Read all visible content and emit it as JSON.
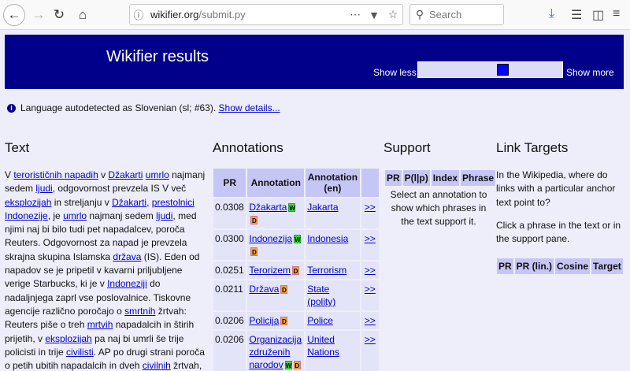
{
  "browser": {
    "url_host": "wikifier.org",
    "url_path": "/submit.py",
    "search_placeholder": "Search"
  },
  "header": {
    "title": "Wikifier results",
    "show_less": "Show less",
    "show_more": "Show more",
    "slider_level": 0.6
  },
  "lang_notice": {
    "text": "Language autodetected as Slovenian (sl; #63). ",
    "link": "Show details..."
  },
  "sections": {
    "text": "Text",
    "annotations": "Annotations",
    "support": "Support",
    "link_targets": "Link Targets"
  },
  "text_body": [
    {
      "t": "V "
    },
    {
      "l": "terorističnih napadih"
    },
    {
      "t": " v "
    },
    {
      "l": "Džakarti"
    },
    {
      "t": " "
    },
    {
      "l": "umrlo"
    },
    {
      "t": " najmanj sedem "
    },
    {
      "l": "ljudi"
    },
    {
      "t": ", odgovornost prevzela IS V več "
    },
    {
      "l": "eksplozijah"
    },
    {
      "t": " in streljanju v "
    },
    {
      "l": "Džakarti"
    },
    {
      "t": ", "
    },
    {
      "l": "prestolnici"
    },
    {
      "t": " "
    },
    {
      "l": "Indonezije"
    },
    {
      "t": ", je "
    },
    {
      "l": "umrlo"
    },
    {
      "t": " najmanj sedem "
    },
    {
      "l": "ljudi"
    },
    {
      "t": ", med njimi naj bi bilo tudi pet napadalcev, poroča Reuters. Odgovornost za napad je prevzela skrajna skupina Islamska "
    },
    {
      "l": "država"
    },
    {
      "t": " (IS).  Eden od napadov se je pripetil v kavarni priljubljene verige Starbucks, ki je v "
    },
    {
      "l": "Indoneziji"
    },
    {
      "t": " do nadaljnjega zaprl vse poslovalnice. Tiskovne agencije različno poročajo o "
    },
    {
      "l": "smrtnih"
    },
    {
      "t": " žrtvah: Reuters piše o treh "
    },
    {
      "l": "mrtvih"
    },
    {
      "t": " napadalcih in štirih prijetih, v "
    },
    {
      "l": "eksplozijah"
    },
    {
      "t": " pa naj bi umrli še trije policisti in trije "
    },
    {
      "l": "civilisti"
    },
    {
      "t": ". AP po drugi strani poroča o petih ubitih napadalcih in dveh "
    },
    {
      "l": "civilnih"
    },
    {
      "t": " žrtvah,"
    }
  ],
  "annotations": {
    "headers": [
      "PR",
      "Annotation",
      "Annotation (en)",
      ""
    ],
    "rows": [
      {
        "pr": "0.0308",
        "sl": "Džakarta",
        "tags": [
          "W",
          "D"
        ],
        "en": "Jakarta",
        "go": ">>"
      },
      {
        "pr": "0.0300",
        "sl": "Indonezija",
        "tags": [
          "W",
          "D"
        ],
        "en": "Indonesia",
        "go": ">>"
      },
      {
        "pr": "0.0251",
        "sl": "Terorizem",
        "tags": [
          "D"
        ],
        "en": "Terrorism",
        "go": ">>"
      },
      {
        "pr": "0.0211",
        "sl": "Država",
        "tags": [
          "D"
        ],
        "en": "State (polity)",
        "go": ">>"
      },
      {
        "pr": "0.0206",
        "sl": "Policija",
        "tags": [
          "D"
        ],
        "en": "Police",
        "go": ">>"
      },
      {
        "pr": "0.0206",
        "sl": "Organizacija združenih narodov",
        "tags": [
          "W",
          "D"
        ],
        "en": "United Nations",
        "go": ">>"
      }
    ]
  },
  "support": {
    "headers": [
      "PR",
      "P(l|p)",
      "Index",
      "Phrase"
    ],
    "note": "Select an annotation to show which phrases in the text support it."
  },
  "link_targets": {
    "para1": "In the Wikipedia, where do links with a particular anchor text point to?",
    "para2": "Click a phrase in the text or in the support pane.",
    "headers": [
      "PR",
      "PR (lin.)",
      "Cosine",
      "Target"
    ]
  }
}
